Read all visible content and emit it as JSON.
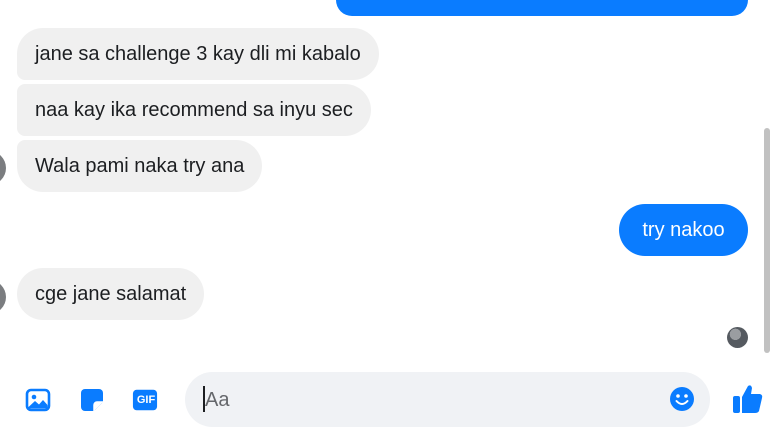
{
  "colors": {
    "accent": "#0a7cff",
    "incoming_bubble": "#f0f0f0",
    "text": "#1c1e21"
  },
  "messages": [
    {
      "direction": "out",
      "text": ""
    },
    {
      "direction": "in",
      "text": "jane sa challenge 3 kay dli mi kabalo"
    },
    {
      "direction": "in",
      "text": "naa kay ika recommend sa inyu sec"
    },
    {
      "direction": "in",
      "text": "Wala pami naka try ana"
    },
    {
      "direction": "out",
      "text": "try nakoo"
    },
    {
      "direction": "in",
      "text": "cge jane salamat"
    }
  ],
  "composer": {
    "placeholder": "Aa",
    "value": "",
    "tools": [
      "image-icon",
      "sticker-icon",
      "gif-icon"
    ],
    "gif_label": "GIF",
    "emoji_icon": "smile-emoji-icon",
    "send_icon": "thumbs-up-icon"
  }
}
